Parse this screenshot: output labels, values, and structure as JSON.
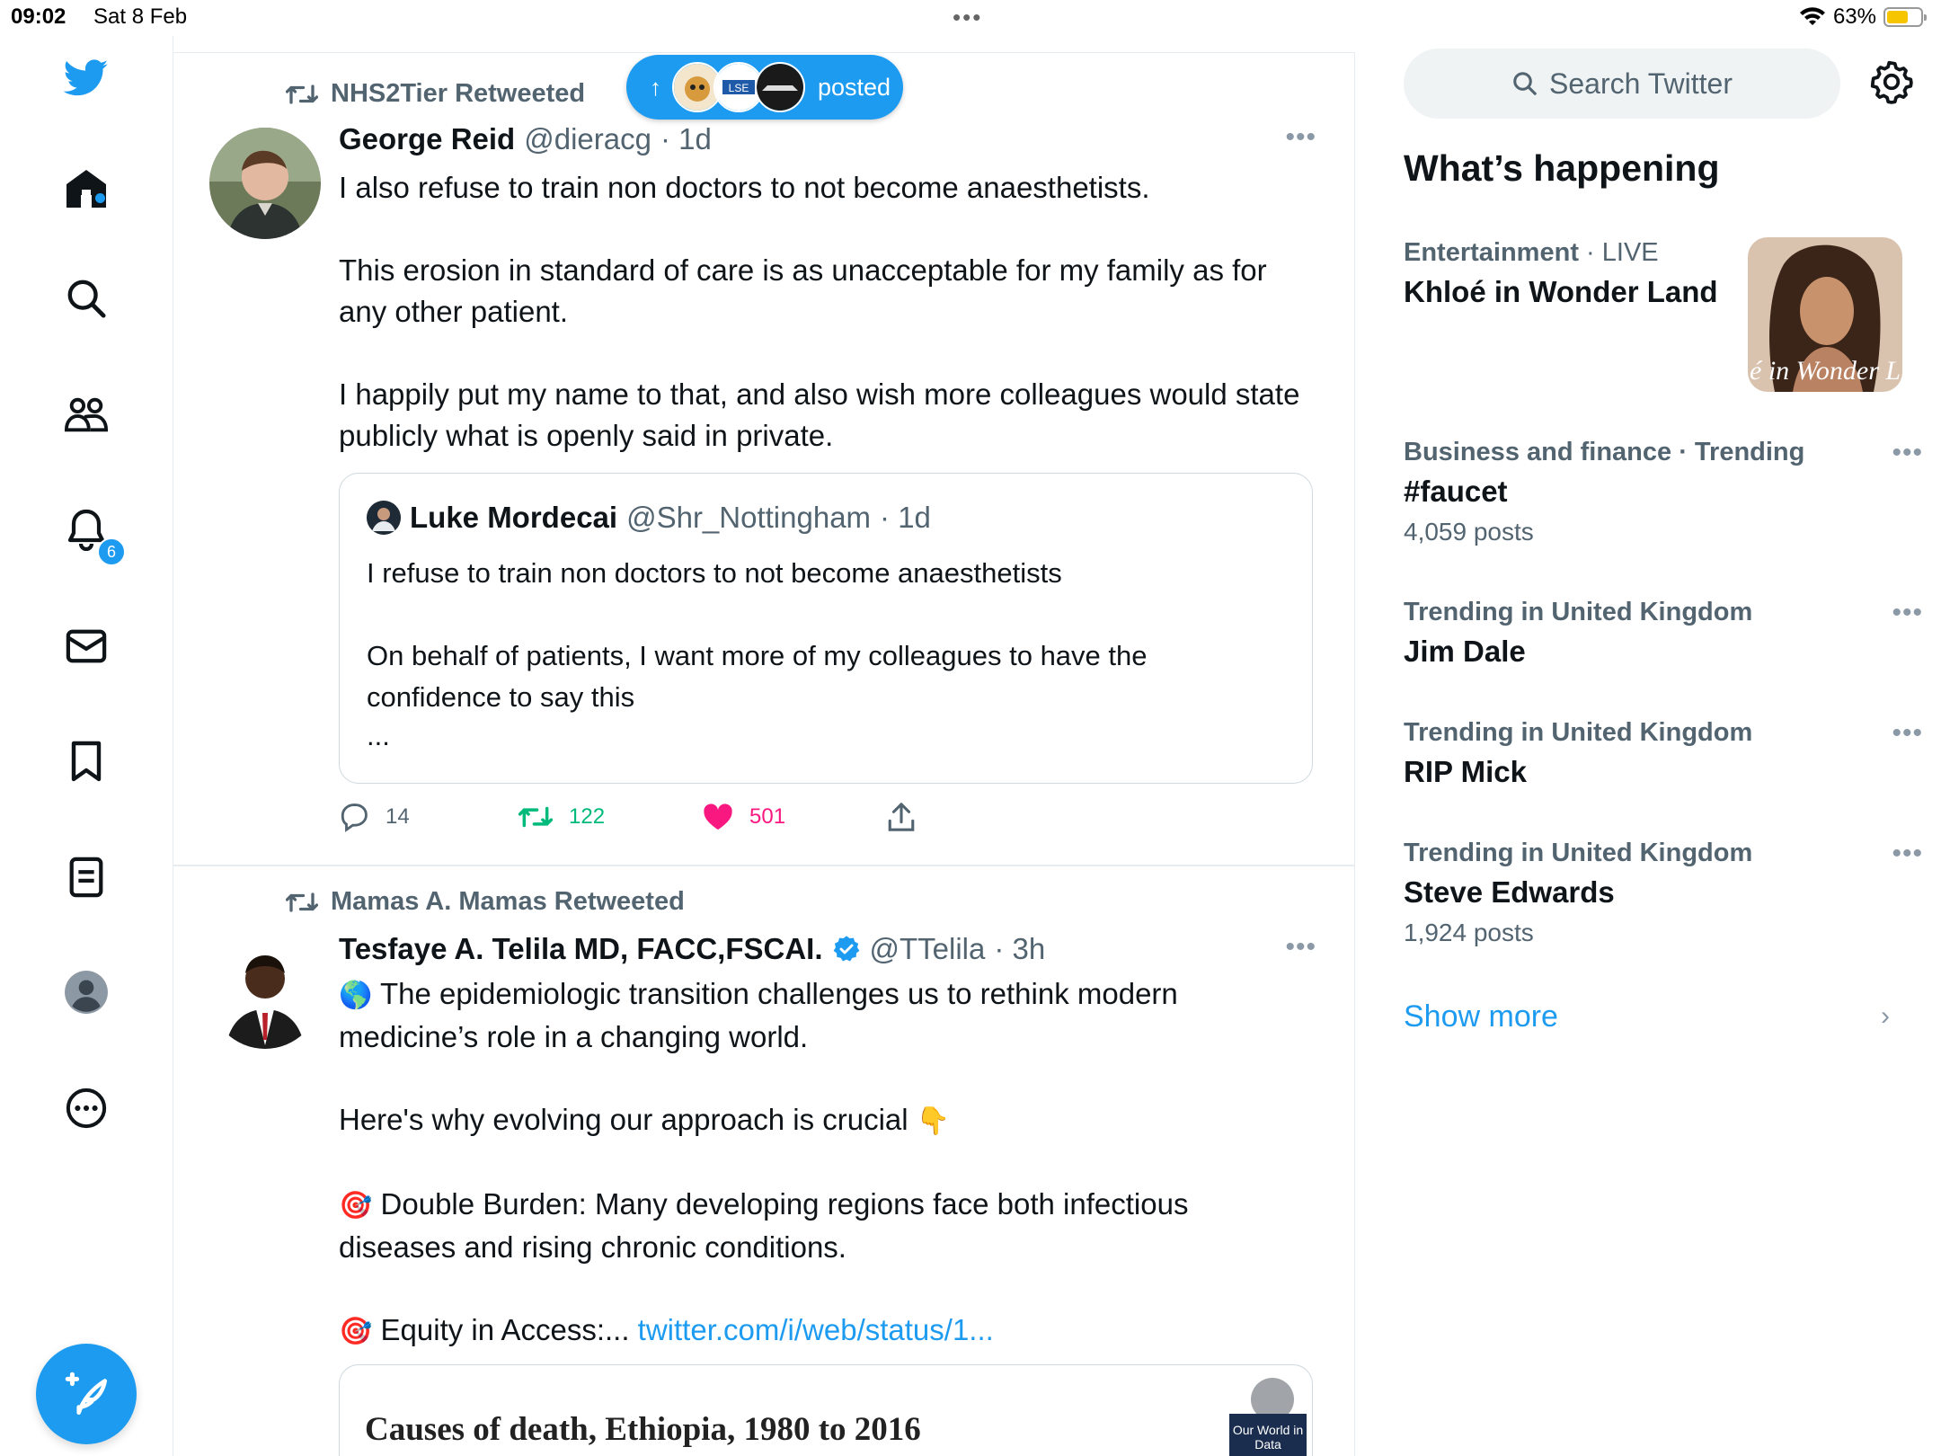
{
  "status_bar": {
    "time": "09:02",
    "date": "Sat 8 Feb",
    "battery": "63%",
    "battery_level": 0.63
  },
  "nav": {
    "notifications_badge": "6",
    "icons": [
      "twitter-logo-icon",
      "home-icon",
      "search-icon",
      "communities-icon",
      "notifications-icon",
      "messages-icon",
      "bookmarks-icon",
      "lists-icon",
      "profile-icon",
      "more-icon",
      "compose-icon"
    ]
  },
  "new_posts_pill": {
    "label": "posted"
  },
  "tweets": [
    {
      "retweeted_by": "NHS2Tier Retweeted",
      "name": "George Reid",
      "handle": "@dieracg",
      "time": "· 1d",
      "body": [
        "I also refuse to train non doctors to not become anaesthetists.",
        "This erosion in standard of care is as unacceptable for my family as for any other patient.",
        "I happily put my name to that, and also wish more colleagues would state publicly what is openly said in private."
      ],
      "quote": {
        "name": "Luke Mordecai",
        "handle": "@Shr_Nottingham",
        "time": "· 1d",
        "body": [
          "I refuse to train non doctors to not become anaesthetists",
          "On behalf of patients, I want more of my colleagues to have the confidence to say this",
          "..."
        ]
      },
      "actions": {
        "replies": "14",
        "retweets": "122",
        "likes": "501"
      }
    },
    {
      "retweeted_by": "Mamas A. Mamas Retweeted",
      "name": "Tesfaye A. Telila MD, FACC,FSCAI.",
      "handle": "@TTelila",
      "time": "· 3h",
      "body": [
        "The epidemiologic transition challenges us to rethink modern medicine’s role in a changing world.",
        "Here's why evolving our approach is crucial",
        "Double Burden: Many developing regions face both infectious diseases and rising chronic conditions.",
        "Equity in Access:...",
        "twitter.com/i/web/status/1..."
      ],
      "media": {
        "title": "Causes of death, Ethiopia, 1980 to 2016",
        "logo": "Our World in Data"
      }
    }
  ],
  "sidebar": {
    "search_placeholder": "Search Twitter",
    "section_title": "What’s happening",
    "trends": [
      {
        "category": "Entertainment",
        "live": "· LIVE",
        "name": "Khloé in Wonder Land",
        "thumb_text": "é in Wonder L"
      },
      {
        "category": "Business and finance · Trending",
        "name": "#faucet",
        "count": "4,059 posts"
      },
      {
        "category": "Trending in United Kingdom",
        "name": "Jim Dale"
      },
      {
        "category": "Trending in United Kingdom",
        "name": "RIP Mick"
      },
      {
        "category": "Trending in United Kingdom",
        "name": "Steve Edwards",
        "count": "1,924 posts"
      }
    ],
    "show_more": "Show more"
  },
  "colors": {
    "accent": "#1d9bf0",
    "retweet_green": "#00ba7c",
    "like_pink": "#f91880",
    "text_secondary": "#536471"
  }
}
